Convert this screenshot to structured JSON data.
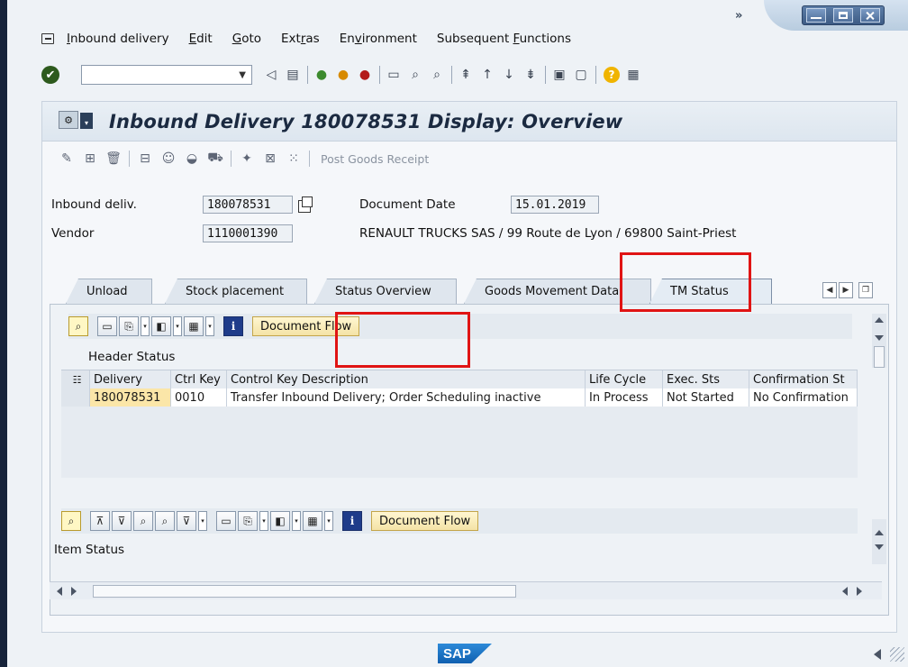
{
  "menu": {
    "items": [
      {
        "label": "Inbound delivery",
        "ul": "I"
      },
      {
        "label": "Edit",
        "ul": "E"
      },
      {
        "label": "Goto",
        "ul": "G"
      },
      {
        "label": "Extras",
        "ul": "r"
      },
      {
        "label": "Environment",
        "ul": "v"
      },
      {
        "label": "Subsequent Functions",
        "ul": "F"
      }
    ],
    "overflow": "»"
  },
  "toolbar": {
    "command_value": ""
  },
  "page": {
    "title": "Inbound Delivery 180078531 Display: Overview"
  },
  "app_toolbar": {
    "post_goods_receipt": "Post Goods Receipt"
  },
  "header": {
    "inbound_label": "Inbound deliv.",
    "inbound_value": "180078531",
    "doc_date_label": "Document Date",
    "doc_date_value": "15.01.2019",
    "vendor_label": "Vendor",
    "vendor_value": "1110001390",
    "vendor_text": "RENAULT TRUCKS SAS / 99 Route de Lyon / 69800 Saint-Priest"
  },
  "tabs": [
    {
      "label": "Unload",
      "active": false
    },
    {
      "label": "Stock placement",
      "active": false
    },
    {
      "label": "Status Overview",
      "active": false
    },
    {
      "label": "Goods Movement Data",
      "active": false
    },
    {
      "label": "TM Status",
      "active": true
    }
  ],
  "header_status": {
    "section_label": "Header Status",
    "doc_flow_label": "Document Flow",
    "columns": [
      "Delivery",
      "Ctrl Key",
      "Control Key Description",
      "Life Cycle",
      "Exec. Sts",
      "Confirmation St"
    ],
    "rows": [
      [
        "180078531",
        "0010",
        "Transfer Inbound Delivery; Order Scheduling inactive",
        "In Process",
        "Not Started",
        "No Confirmation"
      ]
    ]
  },
  "item_status": {
    "section_label": "Item Status",
    "doc_flow_label": "Document Flow"
  },
  "status_bar": {
    "logo": "SAP"
  },
  "colors": {
    "highlight_red": "#e01414",
    "selected_cell": "#fbe6a8",
    "title_text": "#1b2a41"
  }
}
